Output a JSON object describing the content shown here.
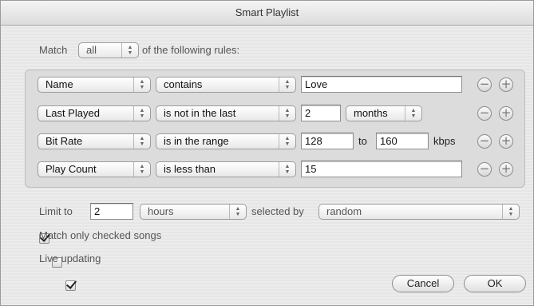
{
  "window": {
    "title": "Smart Playlist"
  },
  "match": {
    "checked": true,
    "label": "Match",
    "quantifier": "all",
    "suffix": "of the following rules:"
  },
  "rules": [
    {
      "field": "Name",
      "operator": "contains",
      "value": "Love"
    },
    {
      "field": "Last Played",
      "operator": "is not in the last",
      "value": "2",
      "unit": "months"
    },
    {
      "field": "Bit Rate",
      "operator": "is in the range",
      "value": "128",
      "connector": "to",
      "value2": "160",
      "unit": "kbps"
    },
    {
      "field": "Play Count",
      "operator": "is less than",
      "value": "15"
    }
  ],
  "rule_buttons": {
    "remove": "−",
    "add": "+"
  },
  "limit": {
    "checked": true,
    "label": "Limit to",
    "value": "2",
    "unit": "hours",
    "selected_by_label": "selected by",
    "selected_by": "random"
  },
  "match_checked_only": {
    "checked": false,
    "label": "Match only checked songs"
  },
  "live_updating": {
    "checked": true,
    "label": "Live updating"
  },
  "buttons": {
    "cancel": "Cancel",
    "ok": "OK"
  },
  "icons": {
    "popup_arrows": "up-down-arrows-icon",
    "checkmark": "checkmark-icon"
  }
}
